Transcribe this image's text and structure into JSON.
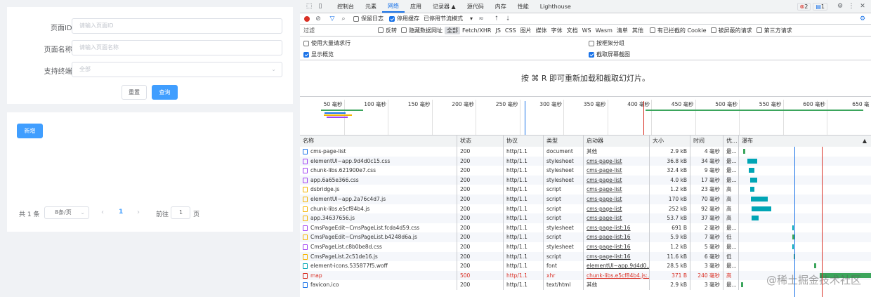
{
  "search": {
    "page_id_label": "页面ID:",
    "page_id_placeholder": "请输入页面ID",
    "page_name_label": "页面名称:",
    "page_name_placeholder": "请输入页面名称",
    "terminal_label": "支持终端:",
    "terminal_value": "全部",
    "reset_label": "重置",
    "query_label": "查询"
  },
  "list": {
    "add_label": "新增",
    "total_text": "共 1 条",
    "page_size": "8条/页",
    "current_page": "1",
    "goto_label": "前往",
    "goto_value": "1",
    "page_suffix": "页"
  },
  "devtools": {
    "tabs": [
      "控制台",
      "元素",
      "网络",
      "应用",
      "记录器 ▲",
      "源代码",
      "内存",
      "性能",
      "Lighthouse"
    ],
    "selected_tab": "网络",
    "error_count": "2",
    "message_count": "1",
    "toolbar": {
      "preserve_log": "保留日志",
      "disable_cache": "停用缓存",
      "throttle": "已停用节流模式"
    },
    "filter": {
      "placeholder": "过滤",
      "invert": "反转",
      "hide_data_urls": "隐藏数据网址",
      "types": [
        "全部",
        "Fetch/XHR",
        "JS",
        "CSS",
        "图片",
        "媒体",
        "字体",
        "文档",
        "WS",
        "Wasm",
        "清单",
        "其他"
      ],
      "blocked_cookies": "有已拦截的 Cookie",
      "blocked_requests": "被屏蔽的请求",
      "third_party": "第三方请求"
    },
    "options": {
      "big_rows": "使用大量请求行",
      "overview": "显示概览",
      "group_by_frame": "按框架分组",
      "screenshots": "截取屏幕截图"
    },
    "hint": "按 ⌘ R 即可重新加载和截取幻灯片。",
    "ticks": [
      "50 毫秒",
      "100 毫秒",
      "150 毫秒",
      "200 毫秒",
      "250 毫秒",
      "300 毫秒",
      "350 毫秒",
      "400 毫秒",
      "450 毫秒",
      "500 毫秒",
      "550 毫秒",
      "600 毫秒",
      "650 毫"
    ],
    "columns": {
      "name": "名称",
      "status": "状态",
      "protocol": "协议",
      "type": "类型",
      "initiator": "启动器",
      "size": "大小",
      "time": "时间",
      "priority": "优...",
      "waterfall": "瀑布"
    },
    "rows": [
      {
        "name": "cms-page-list",
        "status": "200",
        "protocol": "http/1.1",
        "type": "document",
        "initiator": "其他",
        "size": "2.9 kB",
        "time": "4 毫秒",
        "priority": "最...",
        "icon": "document-icon"
      },
      {
        "name": "elementUI~app.9d4d0c15.css",
        "status": "200",
        "protocol": "http/1.1",
        "type": "stylesheet",
        "initiator": "cms-page-list",
        "size": "36.8 kB",
        "time": "34 毫秒",
        "priority": "最...",
        "icon": "stylesheet-icon"
      },
      {
        "name": "chunk-libs.621900e7.css",
        "status": "200",
        "protocol": "http/1.1",
        "type": "stylesheet",
        "initiator": "cms-page-list",
        "size": "32.4 kB",
        "time": "9 毫秒",
        "priority": "最...",
        "icon": "stylesheet-icon"
      },
      {
        "name": "app.6a65e366.css",
        "status": "200",
        "protocol": "http/1.1",
        "type": "stylesheet",
        "initiator": "cms-page-list",
        "size": "4.0 kB",
        "time": "17 毫秒",
        "priority": "最...",
        "icon": "stylesheet-icon"
      },
      {
        "name": "dsbridge.js",
        "status": "200",
        "protocol": "http/1.1",
        "type": "script",
        "initiator": "cms-page-list",
        "size": "1.2 kB",
        "time": "23 毫秒",
        "priority": "高",
        "icon": "script-icon"
      },
      {
        "name": "elementUI~app.2a76c4d7.js",
        "status": "200",
        "protocol": "http/1.1",
        "type": "script",
        "initiator": "cms-page-list",
        "size": "170 kB",
        "time": "70 毫秒",
        "priority": "高",
        "icon": "script-icon"
      },
      {
        "name": "chunk-libs.e5cf84b4.js",
        "status": "200",
        "protocol": "http/1.1",
        "type": "script",
        "initiator": "cms-page-list",
        "size": "252 kB",
        "time": "92 毫秒",
        "priority": "高",
        "icon": "script-icon"
      },
      {
        "name": "app.34637656.js",
        "status": "200",
        "protocol": "http/1.1",
        "type": "script",
        "initiator": "cms-page-list",
        "size": "53.7 kB",
        "time": "37 毫秒",
        "priority": "高",
        "icon": "script-icon"
      },
      {
        "name": "CmsPageEdit~CmsPageList.fcda4d59.css",
        "status": "200",
        "protocol": "http/1.1",
        "type": "stylesheet",
        "initiator": "cms-page-list:16",
        "size": "691 B",
        "time": "2 毫秒",
        "priority": "最...",
        "icon": "stylesheet-icon"
      },
      {
        "name": "CmsPageEdit~CmsPageList.b4248d6a.js",
        "status": "200",
        "protocol": "http/1.1",
        "type": "script",
        "initiator": "cms-page-list:16",
        "size": "5.9 kB",
        "time": "7 毫秒",
        "priority": "低",
        "icon": "script-icon"
      },
      {
        "name": "CmsPageList.c8b0be8d.css",
        "status": "200",
        "protocol": "http/1.1",
        "type": "stylesheet",
        "initiator": "cms-page-list:16",
        "size": "1.2 kB",
        "time": "5 毫秒",
        "priority": "最...",
        "icon": "stylesheet-icon"
      },
      {
        "name": "CmsPageList.2c51de16.js",
        "status": "200",
        "protocol": "http/1.1",
        "type": "script",
        "initiator": "cms-page-list:16",
        "size": "11.6 kB",
        "time": "6 毫秒",
        "priority": "低",
        "icon": "script-icon"
      },
      {
        "name": "element-icons.535877f5.woff",
        "status": "200",
        "protocol": "http/1.1",
        "type": "font",
        "initiator": "elementUI~app.9d4d0...",
        "size": "28.5 kB",
        "time": "3 毫秒",
        "priority": "最...",
        "icon": "font-icon"
      },
      {
        "name": "map",
        "status": "500",
        "protocol": "http/1.1",
        "type": "xhr",
        "initiator": "chunk-libs.e5cf84b4.js:...",
        "size": "371 B",
        "time": "240 毫秒",
        "priority": "高",
        "icon": "xhr-icon",
        "error": true
      },
      {
        "name": "favicon.ico",
        "status": "200",
        "protocol": "http/1.1",
        "type": "text/html",
        "initiator": "其他",
        "size": "2.9 kB",
        "time": "3 毫秒",
        "priority": "最...",
        "icon": "document-icon"
      }
    ]
  },
  "watermark": "@稀土掘金技术社区",
  "colors": {
    "primary": "#409eff",
    "devtools_blue": "#1a73e8",
    "error": "#d93025"
  }
}
